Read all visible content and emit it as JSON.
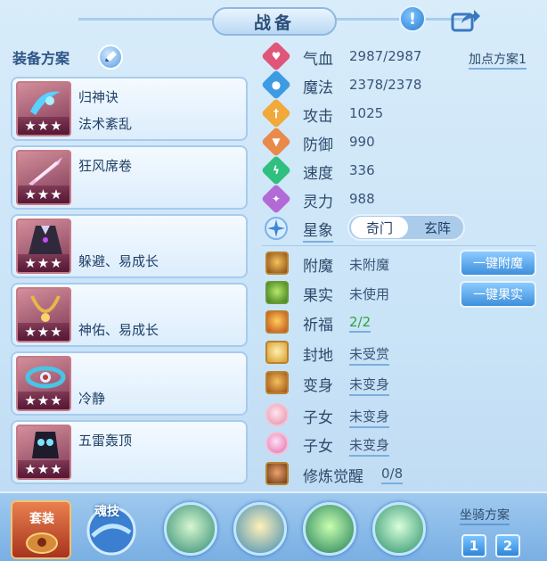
{
  "header": {
    "title": "战备"
  },
  "equipment": {
    "section_title": "装备方案",
    "cards": [
      {
        "line1": "归神诀",
        "line2": "法术紊乱",
        "stars": "★★★"
      },
      {
        "line1": "狂风席卷",
        "line2": "",
        "stars": "★★★"
      },
      {
        "line1": "",
        "line2": "躲避、易成长",
        "stars": "★★★"
      },
      {
        "line1": "",
        "line2": "神佑、易成长",
        "stars": "★★★"
      },
      {
        "line1": "",
        "line2": "冷静",
        "stars": "★★★"
      },
      {
        "line1": "五雷轰顶",
        "line2": "",
        "stars": "★★★"
      }
    ]
  },
  "attributes": {
    "plan_label": "加点方案1",
    "hp": {
      "name": "气血",
      "value": "2987/2987",
      "color": "#e0567a"
    },
    "mp": {
      "name": "魔法",
      "value": "2378/2378",
      "color": "#3d9be4"
    },
    "atk": {
      "name": "攻击",
      "value": "1025",
      "color": "#f0a93a"
    },
    "def": {
      "name": "防御",
      "value": "990",
      "color": "#e98a4b"
    },
    "spd": {
      "name": "速度",
      "value": "336",
      "color": "#2fbf7e"
    },
    "spi": {
      "name": "灵力",
      "value": "988",
      "color": "#b26bd6"
    },
    "star": {
      "name": "星象",
      "tab_active": "奇门",
      "tab_inactive": "玄阵"
    }
  },
  "extras": {
    "enchant": {
      "name": "附魔",
      "value": "未附魔"
    },
    "fruit": {
      "name": "果实",
      "value": "未使用"
    },
    "bless": {
      "name": "祈福",
      "value": "2/2"
    },
    "fengdi": {
      "name": "封地",
      "value": "未受赏"
    },
    "transform": {
      "name": "变身",
      "value": "未变身"
    },
    "child1": {
      "name": "子女",
      "value": "未变身"
    },
    "child2": {
      "name": "子女",
      "value": "未变身"
    },
    "awaken": {
      "name": "修炼觉醒",
      "value": "0/8"
    },
    "btn_enchant": "一键附魔",
    "btn_fruit": "一键果实"
  },
  "bottom": {
    "suit_label": "套装",
    "soul_label": "魂技",
    "mount_title": "坐骑方案",
    "mount_1": "1",
    "mount_2": "2"
  }
}
